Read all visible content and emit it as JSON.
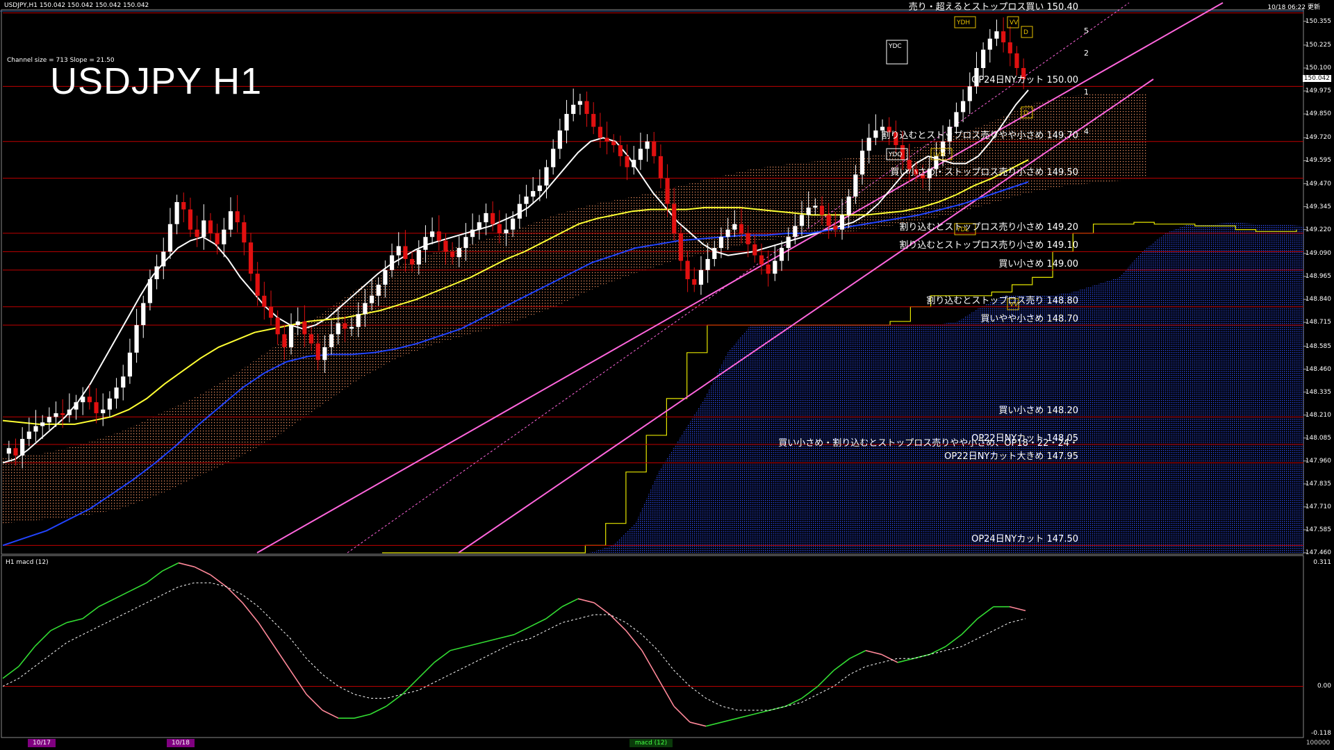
{
  "header": {
    "symbol_info": "USDJPY,H1  150.042 150.042 150.042 150.042",
    "channel_info": "Channel size = 713 Slope = 21.50",
    "title": "USDJPY H1",
    "timestamp": "10/18 06:22 更新",
    "current_price": "150.042"
  },
  "chart_data": [
    {
      "type": "candlestick",
      "title": "USDJPY H1",
      "ylim": [
        147.46,
        150.41
      ],
      "y_ticks": [
        "150.355",
        "150.225",
        "150.100",
        "149.975",
        "149.850",
        "149.720",
        "149.595",
        "149.470",
        "149.345",
        "149.220",
        "149.090",
        "148.965",
        "148.840",
        "148.715",
        "148.585",
        "148.460",
        "148.335",
        "148.210",
        "148.085",
        "147.960",
        "147.835",
        "147.710",
        "147.585",
        "147.460"
      ],
      "close_series": [
        148.03,
        147.99,
        148.08,
        148.12,
        148.15,
        148.17,
        148.2,
        148.22,
        148.21,
        148.24,
        148.28,
        148.31,
        148.28,
        148.22,
        148.24,
        148.3,
        148.36,
        148.42,
        148.55,
        148.7,
        148.82,
        148.95,
        149.02,
        149.1,
        149.25,
        149.37,
        149.33,
        149.22,
        149.18,
        149.27,
        149.2,
        149.14,
        149.22,
        149.32,
        149.26,
        149.15,
        148.98,
        148.86,
        148.8,
        148.74,
        148.65,
        148.58,
        148.7,
        148.72,
        148.65,
        148.6,
        148.51,
        148.58,
        148.65,
        148.71,
        148.68,
        148.69,
        148.76,
        148.82,
        148.86,
        148.92,
        149.0,
        149.08,
        149.13,
        149.06,
        149.03,
        149.11,
        149.18,
        149.21,
        149.16,
        149.1,
        149.07,
        149.12,
        149.18,
        149.22,
        149.26,
        149.31,
        149.25,
        149.2,
        149.22,
        149.28,
        149.36,
        149.4,
        149.43,
        149.46,
        149.56,
        149.66,
        149.76,
        149.85,
        149.9,
        149.92,
        149.85,
        149.78,
        149.72,
        149.7,
        149.68,
        149.62,
        149.56,
        149.6,
        149.66,
        149.7,
        149.62,
        149.5,
        149.36,
        149.2,
        149.05,
        148.95,
        148.92,
        149.0,
        149.06,
        149.12,
        149.18,
        149.22,
        149.25,
        149.2,
        149.14,
        149.08,
        149.03,
        148.98,
        149.05,
        149.12,
        149.18,
        149.24,
        149.3,
        149.34,
        149.35,
        149.3,
        149.24,
        149.22,
        149.3,
        149.4,
        149.52,
        149.65,
        149.72,
        149.76,
        149.78,
        149.75,
        149.68,
        149.6,
        149.55,
        149.52,
        149.5,
        149.55,
        149.62,
        149.7,
        149.78,
        149.86,
        149.92,
        150.0,
        150.1,
        150.2,
        150.26,
        150.3,
        150.24,
        150.18,
        150.1,
        150.04
      ],
      "moving_averages": [
        {
          "color": "#ffffff",
          "values": [
            147.95,
            147.97,
            148.02,
            148.08,
            148.14,
            148.2,
            148.28,
            148.38,
            148.5,
            148.62,
            148.74,
            148.86,
            148.97,
            149.05,
            149.12,
            149.16,
            149.18,
            149.14,
            149.06,
            148.96,
            148.88,
            148.8,
            148.74,
            148.7,
            148.68,
            148.7,
            148.74,
            148.8,
            148.86,
            148.92,
            148.98,
            149.03,
            149.07,
            149.11,
            149.14,
            149.16,
            149.18,
            149.2,
            149.22,
            149.24,
            149.27,
            149.3,
            149.34,
            149.4,
            149.48,
            149.56,
            149.64,
            149.7,
            149.72,
            149.7,
            149.62,
            149.52,
            149.42,
            149.34,
            149.26,
            149.2,
            149.14,
            149.1,
            149.08,
            149.09,
            149.1,
            149.12,
            149.14,
            149.16,
            149.18,
            149.2,
            149.22,
            149.24,
            149.26,
            149.3,
            149.36,
            149.44,
            149.52,
            149.58,
            149.62,
            149.6,
            149.58,
            149.58,
            149.62,
            149.7,
            149.8,
            149.9,
            149.98
          ]
        },
        {
          "color": "#ffff33",
          "values": [
            148.18,
            148.17,
            148.16,
            148.16,
            148.16,
            148.18,
            148.2,
            148.24,
            148.3,
            148.38,
            148.45,
            148.52,
            148.58,
            148.62,
            148.66,
            148.68,
            148.7,
            148.72,
            148.73,
            148.74,
            148.76,
            148.78,
            148.81,
            148.84,
            148.88,
            148.92,
            148.96,
            149.01,
            149.06,
            149.1,
            149.15,
            149.2,
            149.25,
            149.28,
            149.3,
            149.32,
            149.33,
            149.33,
            149.33,
            149.34,
            149.34,
            149.34,
            149.33,
            149.32,
            149.31,
            149.3,
            149.3,
            149.3,
            149.3,
            149.31,
            149.32,
            149.34,
            149.37,
            149.41,
            149.46,
            149.5,
            149.55,
            149.6
          ]
        },
        {
          "color": "#2244ff",
          "values": [
            147.5,
            147.54,
            147.58,
            147.64,
            147.7,
            147.78,
            147.86,
            147.95,
            148.05,
            148.16,
            148.26,
            148.36,
            148.44,
            148.5,
            148.53,
            148.54,
            148.54,
            148.55,
            148.57,
            148.6,
            148.64,
            148.68,
            148.74,
            148.8,
            148.86,
            148.92,
            148.98,
            149.04,
            149.08,
            149.12,
            149.14,
            149.16,
            149.17,
            149.18,
            149.19,
            149.19,
            149.2,
            149.2,
            149.22,
            149.24,
            149.26,
            149.28,
            149.3,
            149.33,
            149.36,
            149.4,
            149.44,
            149.48
          ]
        }
      ],
      "ichimoku_cloud": {
        "upper": [
          147.98,
          148.0,
          148.05,
          148.12,
          148.22,
          148.32,
          148.45,
          148.6,
          148.75,
          148.9,
          149.02,
          149.1,
          149.15,
          149.22,
          149.3,
          149.36,
          149.4,
          149.45,
          149.5,
          149.55,
          149.58,
          149.6,
          149.62,
          149.66,
          149.72,
          149.8,
          149.9,
          149.95,
          149.96,
          149.96
        ],
        "lower": [
          147.62,
          147.64,
          147.66,
          147.7,
          147.78,
          147.88,
          147.98,
          148.1,
          148.25,
          148.4,
          148.52,
          148.6,
          148.66,
          148.72,
          148.8,
          148.9,
          148.98,
          149.05,
          149.1,
          149.15,
          149.18,
          149.2,
          149.22,
          149.26,
          149.3,
          149.36,
          149.42,
          149.46,
          149.48,
          149.5
        ]
      },
      "yellow_step_line": [
        147.46,
        147.46,
        147.46,
        147.46,
        147.46,
        147.46,
        147.46,
        147.46,
        147.46,
        147.46,
        147.5,
        147.62,
        147.9,
        148.1,
        148.3,
        148.55,
        148.7,
        148.7,
        148.7,
        148.7,
        148.7,
        148.7,
        148.7,
        148.7,
        148.7,
        148.72,
        148.8,
        148.86,
        148.86,
        148.86,
        148.88,
        148.92,
        148.96,
        149.1,
        149.2,
        149.25,
        149.25,
        149.26,
        149.25,
        149.25,
        149.24,
        149.24,
        149.22,
        149.21,
        149.21,
        149.22
      ],
      "blue_fill_series": [
        147.46,
        147.46,
        147.46,
        147.46,
        147.46,
        147.46,
        147.46,
        147.46,
        147.46,
        147.46,
        147.5,
        147.62,
        147.9,
        148.1,
        148.3,
        148.55,
        148.7,
        148.7,
        148.7,
        148.7,
        148.7,
        148.7,
        148.7,
        148.7,
        148.7,
        148.72,
        148.8,
        148.86,
        148.86,
        148.86,
        148.88,
        148.92,
        148.96,
        149.1,
        149.2,
        149.25,
        149.25,
        149.26,
        149.25,
        149.25,
        149.24
      ],
      "horizontal_levels": [
        {
          "price": 150.4,
          "label": "売り・超えるとストップロス買い 150.40"
        },
        {
          "price": 150.0,
          "label": "OP24日NYカット 150.00"
        },
        {
          "price": 149.7,
          "label": "割り込むとストップロス売りやや小さめ 149.70"
        },
        {
          "price": 149.5,
          "label": "買い小さめ・ストップロス売り小さめ 149.50"
        },
        {
          "price": 149.2,
          "label": "割り込むとストップロス売り小さめ 149.20"
        },
        {
          "price": 149.1,
          "label": "割り込むとストップロス売り小さめ 149.10"
        },
        {
          "price": 149.0,
          "label": "買い小さめ 149.00"
        },
        {
          "price": 148.8,
          "label": "割り込むとストップロス売り 148.80"
        },
        {
          "price": 148.7,
          "label": "買いやや小さめ 148.70"
        },
        {
          "price": 148.2,
          "label": "買い小さめ 148.20"
        },
        {
          "price": 148.05,
          "label": "OP22日NYカット 148.05"
        },
        {
          "price": 147.95,
          "label": "買い小さめ・割り込むとストップロス売りやや小さめ、OP18・22・24・\nOP22日NYカット大きめ 147.95"
        },
        {
          "price": 147.5,
          "label": "OP24日NYカット 147.50"
        }
      ],
      "channel_labels": [
        "1",
        "2",
        "4",
        "5"
      ],
      "boxes": [
        "YDH",
        "VV",
        "D",
        "YDC",
        "YDQ",
        "LVH",
        "YDL",
        "VV",
        "D"
      ]
    },
    {
      "type": "line",
      "title": "H1  macd (12)",
      "ylim": [
        -0.118,
        0.311
      ],
      "y_ticks": [
        "0.311",
        "0.00",
        "-0.118"
      ],
      "macd": [
        0.02,
        0.05,
        0.1,
        0.14,
        0.16,
        0.17,
        0.2,
        0.22,
        0.24,
        0.26,
        0.29,
        0.31,
        0.3,
        0.28,
        0.25,
        0.21,
        0.16,
        0.1,
        0.04,
        -0.02,
        -0.06,
        -0.08,
        -0.08,
        -0.07,
        -0.05,
        -0.02,
        0.02,
        0.06,
        0.09,
        0.1,
        0.11,
        0.12,
        0.13,
        0.15,
        0.17,
        0.2,
        0.22,
        0.21,
        0.18,
        0.14,
        0.09,
        0.02,
        -0.05,
        -0.09,
        -0.1,
        -0.09,
        -0.08,
        -0.07,
        -0.06,
        -0.05,
        -0.03,
        0.0,
        0.04,
        0.07,
        0.09,
        0.08,
        0.06,
        0.07,
        0.08,
        0.1,
        0.13,
        0.17,
        0.2,
        0.2,
        0.19
      ],
      "signal": [
        0.0,
        0.02,
        0.05,
        0.08,
        0.11,
        0.13,
        0.15,
        0.17,
        0.19,
        0.21,
        0.23,
        0.25,
        0.26,
        0.26,
        0.25,
        0.23,
        0.2,
        0.16,
        0.12,
        0.07,
        0.03,
        0.0,
        -0.02,
        -0.03,
        -0.03,
        -0.02,
        -0.01,
        0.01,
        0.03,
        0.05,
        0.07,
        0.09,
        0.11,
        0.12,
        0.14,
        0.16,
        0.17,
        0.18,
        0.18,
        0.16,
        0.13,
        0.09,
        0.04,
        0.0,
        -0.03,
        -0.05,
        -0.06,
        -0.06,
        -0.06,
        -0.05,
        -0.04,
        -0.02,
        0.0,
        0.03,
        0.05,
        0.06,
        0.07,
        0.07,
        0.08,
        0.09,
        0.1,
        0.12,
        0.14,
        0.16,
        0.17
      ]
    }
  ],
  "bottom_tabs": [
    "10/17",
    "10/18",
    "macd (12)",
    "100000"
  ]
}
